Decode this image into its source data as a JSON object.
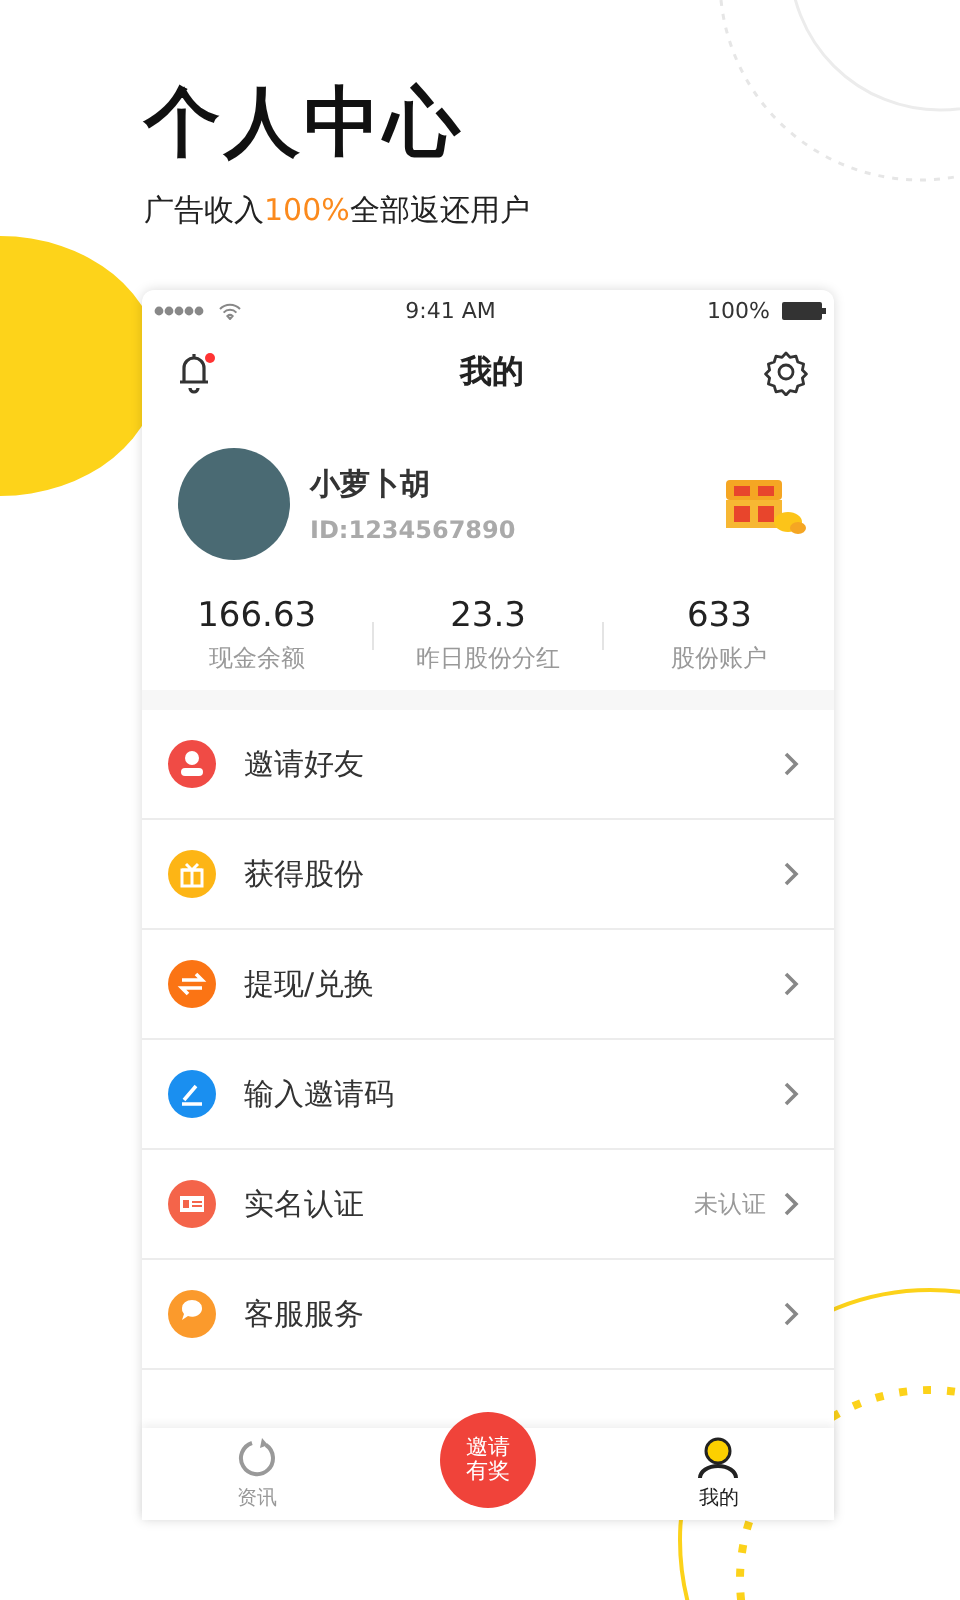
{
  "header": {
    "title": "个人中心",
    "subtitle": {
      "before": "广告收入",
      "highlight": "100%",
      "after": "全部返还用户"
    }
  },
  "status_bar": {
    "time": "9:41 AM",
    "battery": "100%"
  },
  "nav": {
    "title": "我的",
    "unread": true
  },
  "profile": {
    "name": "小萝卜胡",
    "id": "ID:1234567890"
  },
  "stats": [
    {
      "value": "166.63",
      "label": "现金余额"
    },
    {
      "value": "23.3",
      "label": "昨日股份分红"
    },
    {
      "value": "633",
      "label": "股份账户"
    }
  ],
  "menu": [
    {
      "label": "邀请好友",
      "kind": "person",
      "color": "#f04b45"
    },
    {
      "label": "获得股份",
      "kind": "gift",
      "color": "#fdb515"
    },
    {
      "label": "提现/兑换",
      "kind": "swap",
      "color": "#fb7414"
    },
    {
      "label": "输入邀请码",
      "kind": "pen",
      "color": "#1a8ff0"
    },
    {
      "label": "实名认证",
      "kind": "card",
      "color": "#f4644a",
      "detail": "未认证"
    },
    {
      "label": "客服服务",
      "kind": "chat",
      "color": "#fb9a2c"
    }
  ],
  "tabs": [
    {
      "kind": "tab",
      "label": "资讯",
      "selected": false
    },
    {
      "kind": "promo",
      "lines": [
        "邀请",
        "有奖"
      ]
    },
    {
      "kind": "tab",
      "label": "我的",
      "selected": true
    }
  ]
}
